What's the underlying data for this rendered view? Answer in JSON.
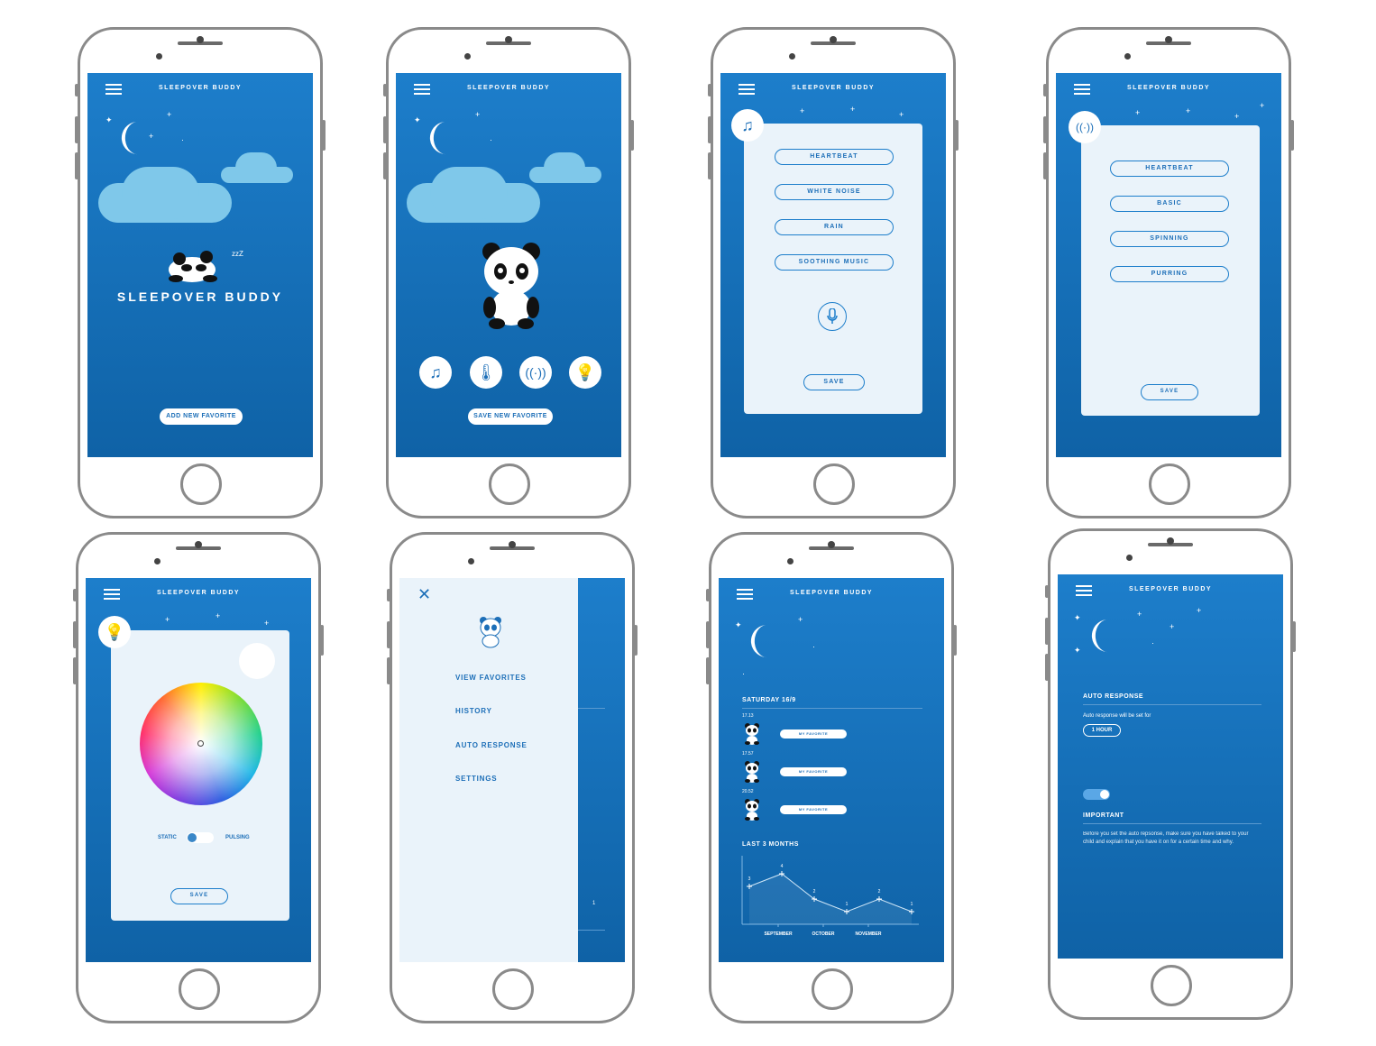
{
  "app": {
    "title": "SLEEPOVER BUDDY"
  },
  "screen1": {
    "title": "SLEEPOVER BUDDY",
    "splash_title": "SLEEPOVER BUDDY",
    "zzz": "zzZ",
    "add_button": "ADD NEW FAVORITE"
  },
  "screen2": {
    "title": "SLEEPOVER BUDDY",
    "save_button": "SAVE NEW FAVORITE",
    "icons": [
      "music-icon",
      "thermometer-icon",
      "panda-vibration-icon",
      "lightbulb-icon"
    ]
  },
  "screen3": {
    "title": "SLEEPOVER BUDDY",
    "options": [
      "HEARTBEAT",
      "WHITE NOISE",
      "RAIN",
      "SOOTHING MUSIC"
    ],
    "save": "SAVE"
  },
  "screen4": {
    "title": "SLEEPOVER BUDDY",
    "options": [
      "HEARTBEAT",
      "BASIC",
      "SPINNING",
      "PURRING"
    ],
    "save": "SAVE"
  },
  "screen5": {
    "title": "SLEEPOVER BUDDY",
    "static": "STATIC",
    "pulsing": "PULSING",
    "save": "SAVE"
  },
  "screen6": {
    "menu": [
      "VIEW FAVORITES",
      "HISTORY",
      "AUTO RESPONSE",
      "SETTINGS"
    ],
    "peek_value": "1"
  },
  "screen7": {
    "title": "SLEEPOVER BUDDY",
    "date": "SATURDAY 16/9",
    "entries": [
      {
        "time": "17.13",
        "label": "MY FAVORITE"
      },
      {
        "time": "17.57",
        "label": "MY FAVORITE"
      },
      {
        "time": "20.52",
        "label": "MY FAVORITE"
      }
    ],
    "chart_heading": "LAST 3 MONTHS"
  },
  "screen8": {
    "title": "SLEEPOVER BUDDY",
    "auto_heading": "AUTO RESPONSE",
    "auto_text": "Auto response will be set for",
    "duration": "1 HOUR",
    "important_heading": "IMPORTANT",
    "important_text": "Before you set the auto repsonse, make sure you have talked to your child and explain that you have it on for a certain time and why."
  },
  "chart_data": {
    "type": "line",
    "title": "LAST 3 MONTHS",
    "categories": [
      "SEPTEMBER",
      "OCTOBER",
      "NOVEMBER"
    ],
    "x_points": 6,
    "series": [
      {
        "values": [
          3,
          4,
          2,
          1,
          2,
          1
        ]
      }
    ],
    "ylim": [
      0,
      5
    ],
    "grid": false
  }
}
